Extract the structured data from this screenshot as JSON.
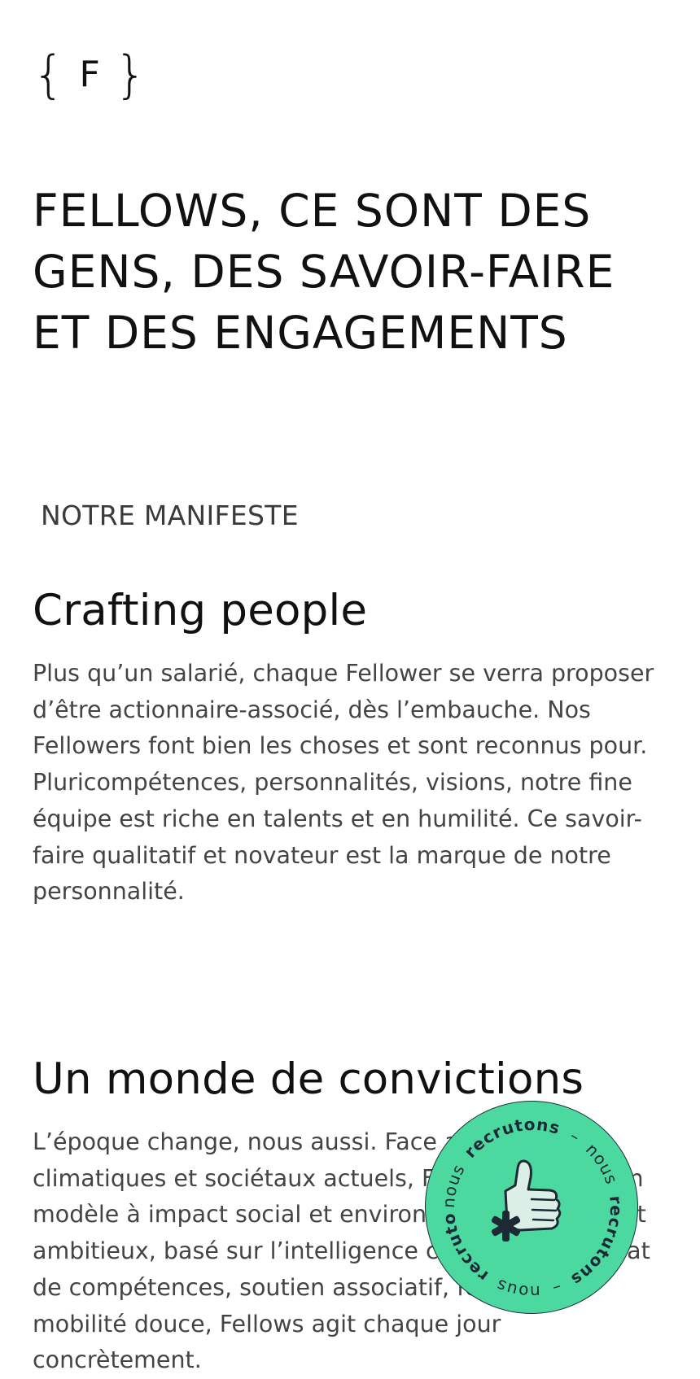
{
  "logo": {
    "left_brace": "{",
    "letter": "F",
    "right_brace": "}"
  },
  "hero": {
    "title": "FELLOWS, CE SONT DES GENS, DES SAVOIR-FAIRE ET DES ENGAGEMENTS"
  },
  "manifesto": {
    "label": "NOTRE MANIFESTE"
  },
  "sections": [
    {
      "heading": "Crafting people",
      "text": "Plus qu’un salarié, chaque Fellower se verra proposer d’être actionnaire-associé, dès l’embauche. Nos Fellowers font bien les choses et sont reconnus pour. Pluricompétences, personnalités, visions, notre fine équipe est riche en talents et en humilité. Ce savoir-faire qualitatif et novateur est la marque de notre personnalité."
    },
    {
      "heading": "Un monde de convictions",
      "text": "L’époque change, nous aussi. Face aux enjeux climatiques et sociétaux actuels, Fellows propose un modèle à impact social et environnemental positif et ambitieux, basé sur l’intelligence collective. Mécénat de compétences, soutien associatif, formation, mobilité douce, Fellows agit chaque jour concrètement."
    }
  ],
  "recruit_badge": {
    "word_light": "nous",
    "word_bold": "recrutons",
    "separator": "–",
    "icon": "thumbs-up-icon",
    "background_color": "#4cd9a0",
    "ink_color": "#1d2a36",
    "hand_color": "#dcefe6"
  }
}
